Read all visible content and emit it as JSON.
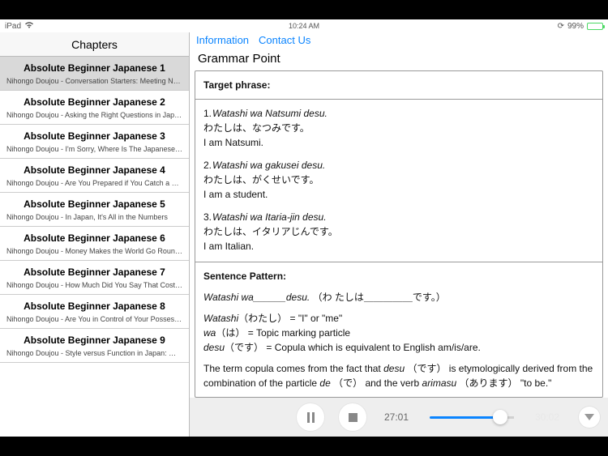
{
  "status": {
    "device": "iPad",
    "time": "10:24 AM",
    "battery_pct": "99%"
  },
  "sidebar": {
    "title": "Chapters",
    "items": [
      {
        "title": "Absolute Beginner Japanese 1",
        "subtitle": "Nihongo Doujou - Conversation Starters: Meeting New Peopl..."
      },
      {
        "title": "Absolute Beginner Japanese 2",
        "subtitle": "Nihongo Doujou - Asking the Right Questions in Japanese!"
      },
      {
        "title": "Absolute Beginner Japanese 3",
        "subtitle": "Nihongo Doujou - I'm Sorry, Where Is The Japanese Food I..."
      },
      {
        "title": "Absolute Beginner Japanese 4",
        "subtitle": "Nihongo Doujou - Are You Prepared if You Catch a Cold in J..."
      },
      {
        "title": "Absolute Beginner Japanese 5",
        "subtitle": "Nihongo Doujou - In Japan, It's All in the Numbers"
      },
      {
        "title": "Absolute Beginner Japanese 6",
        "subtitle": "Nihongo Doujou - Money Makes the World Go Round in Japan"
      },
      {
        "title": "Absolute Beginner Japanese 7",
        "subtitle": "Nihongo Doujou - How Much Did You Say That Costs in Jap..."
      },
      {
        "title": "Absolute Beginner Japanese 8",
        "subtitle": "Nihongo Doujou - Are You in Control of Your Possessions in ..."
      },
      {
        "title": "Absolute Beginner Japanese 9",
        "subtitle": "Nihongo Doujou - Style versus Function in Japan: Whose U..."
      }
    ],
    "selected_index": 0
  },
  "links": {
    "information": "Information",
    "contact": "Contact Us"
  },
  "section_title": "Grammar Point",
  "content": {
    "target_heading": "Target phrase:",
    "phrases": [
      {
        "n": "1.",
        "romaji": "Watashi wa Natsumi desu.",
        "jp": "わたしは、なつみです。",
        "en": "I am Natsumi."
      },
      {
        "n": "2.",
        "romaji": "Watashi wa gakusei desu.",
        "jp": "わたしは、がくせいです。",
        "en": "I am a student."
      },
      {
        "n": "3.",
        "romaji": "Watashi wa Itaria-jin desu.",
        "jp": "わたしは、イタリアじんです。",
        "en": "I am Italian."
      }
    ],
    "pattern_heading": "Sentence Pattern:",
    "pattern_romaji_a": "Watashi wa",
    "pattern_romaji_b": "desu.",
    "pattern_jp": "（わ たしは＿＿＿＿＿です。）",
    "blank": "______",
    "def1_it": "Watashi",
    "def1_jp": "（わたし）",
    "def1_rest": " = \"I\" or \"me\"",
    "def2_it": "wa",
    "def2_jp": "（は）",
    "def2_rest": " = Topic marking particle",
    "def3_it": "desu",
    "def3_jp": "（です）",
    "def3_rest": " = Copula which is equivalent to English am/is/are.",
    "expl_a": "The term copula comes from the fact that ",
    "expl_it1": "desu",
    "expl_jp1": " （です） ",
    "expl_b": " is etymologically derived from the combination of the particle ",
    "expl_it2": "de",
    "expl_jp2": " （で） ",
    "expl_c": " and the verb ",
    "expl_it3": "arimasu",
    "expl_jp3": " （あります） ",
    "expl_d": " \"to be.\""
  },
  "player": {
    "elapsed": "27:01",
    "duration": "30:02"
  }
}
